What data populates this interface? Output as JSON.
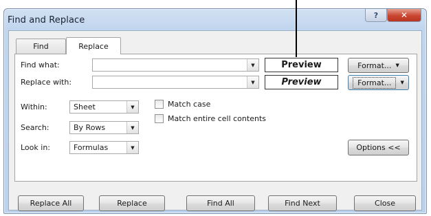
{
  "window": {
    "title": "Find and Replace",
    "help_label": "?",
    "close_label": "✕"
  },
  "tabs": [
    {
      "label": "Find"
    },
    {
      "label": "Replace",
      "active": true
    }
  ],
  "fields": {
    "find_what_label": "Find what:",
    "find_what_value": "",
    "replace_with_label": "Replace with:",
    "replace_with_value": ""
  },
  "previews": {
    "find": "Preview",
    "replace": "Preview"
  },
  "format_buttons": {
    "find": "Format...",
    "replace": "Format..."
  },
  "options": {
    "within_label": "Within:",
    "within_value": "Sheet",
    "search_label": "Search:",
    "search_value": "By Rows",
    "look_in_label": "Look in:",
    "look_in_value": "Formulas",
    "match_case_label": "Match case",
    "match_case_checked": false,
    "match_entire_label": "Match entire cell contents",
    "match_entire_checked": false,
    "options_button": "Options <<"
  },
  "buttons": {
    "replace_all": "Replace All",
    "replace": "Replace",
    "find_all": "Find All",
    "find_next": "Find Next",
    "close": "Close"
  },
  "icons": {
    "dropdown": "chevron-down-icon",
    "help": "help-icon",
    "close": "close-icon"
  },
  "colors": {
    "frame": "#c0d5ee",
    "close_button": "#c9452f",
    "panel": "#ffffff",
    "client": "#f0f0f0"
  }
}
